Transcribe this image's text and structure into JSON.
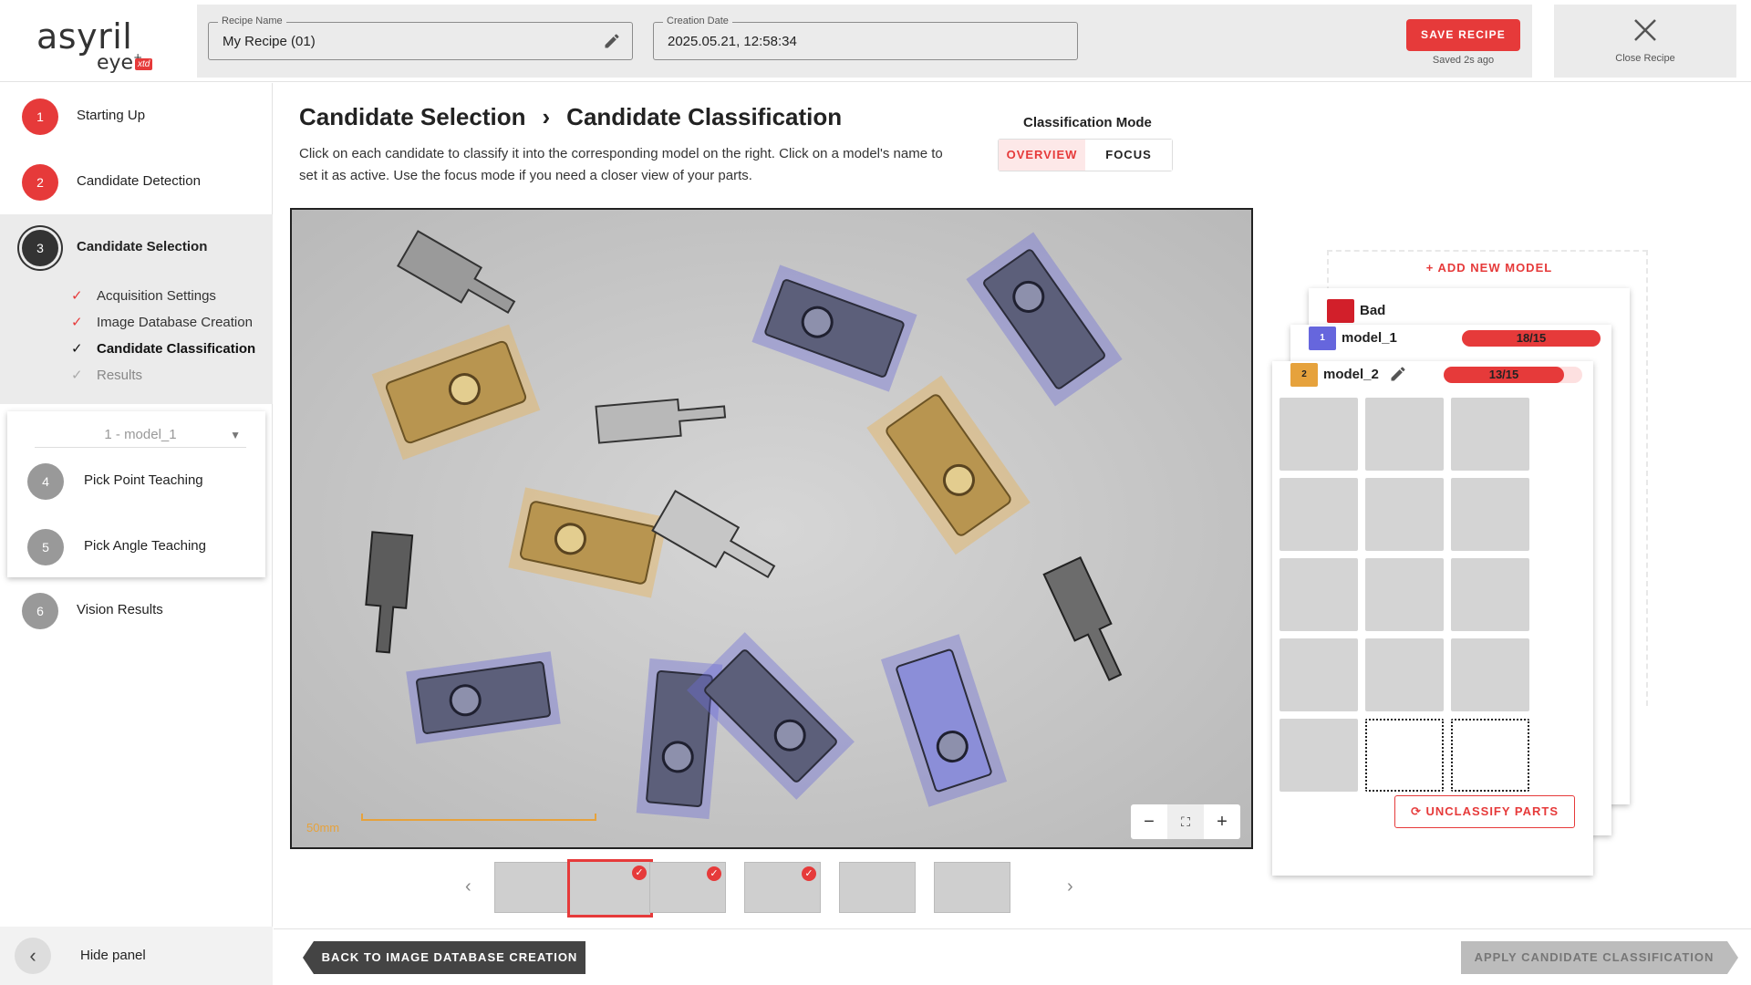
{
  "header": {
    "logo_main": "asyril",
    "logo_sub": "eye",
    "logo_plus": "+",
    "logo_xtd": "xtd",
    "recipe_name_label": "Recipe Name",
    "recipe_name_value": "My Recipe (01)",
    "creation_date_label": "Creation Date",
    "creation_date_value": "2025.05.21, 12:58:34",
    "save_label": "SAVE RECIPE",
    "saved_text": "Saved 2s ago",
    "close_label": "Close Recipe"
  },
  "sidebar": {
    "steps": [
      {
        "num": "1",
        "label": "Starting Up",
        "color": "#e63a3a"
      },
      {
        "num": "2",
        "label": "Candidate Detection",
        "color": "#e63a3a"
      },
      {
        "num": "3",
        "label": "Candidate Selection",
        "color": "#333333"
      },
      {
        "num": "4",
        "label": "Pick Point Teaching",
        "color": "#999999"
      },
      {
        "num": "5",
        "label": "Pick Angle Teaching",
        "color": "#999999"
      },
      {
        "num": "6",
        "label": "Vision Results",
        "color": "#999999"
      }
    ],
    "sub_items": [
      {
        "label": "Acquisition Settings",
        "state": "done"
      },
      {
        "label": "Image Database Creation",
        "state": "done"
      },
      {
        "label": "Candidate Classification",
        "state": "current"
      },
      {
        "label": "Results",
        "state": "pending"
      }
    ],
    "model_select": "1 - model_1",
    "hide_label": "Hide panel"
  },
  "main": {
    "title_part1": "Candidate Selection",
    "title_part2": "Candidate Classification",
    "description": "Click on each candidate to classify it into the corresponding model on the right. Click on a model's name to set it as active. Use the focus mode if you need a closer view of your parts.",
    "mode_label": "Classification Mode",
    "mode_overview": "OVERVIEW",
    "mode_focus": "FOCUS",
    "scale_text": "50mm",
    "zoom_out": "−",
    "zoom_in": "+",
    "back_label": "BACK TO IMAGE DATABASE CREATION",
    "apply_label": "APPLY CANDIDATE CLASSIFICATION"
  },
  "thumbnails": [
    {
      "checked": false,
      "selected": false
    },
    {
      "checked": true,
      "selected": true
    },
    {
      "checked": true,
      "selected": false
    },
    {
      "checked": true,
      "selected": false
    },
    {
      "checked": false,
      "selected": false
    },
    {
      "checked": false,
      "selected": false
    }
  ],
  "models": {
    "add_label": "+ ADD NEW MODEL",
    "bad": {
      "name": "Bad",
      "color": "#d21f2a"
    },
    "model_1": {
      "num": "1",
      "name": "model_1",
      "count": "18/15",
      "color": "#6666dd"
    },
    "model_2": {
      "num": "2",
      "name": "model_2",
      "count": "13/15",
      "color": "#e6a23c"
    },
    "unclassify_label": "UNCLASSIFY PARTS",
    "filled_cells": 13,
    "empty_cells": 2
  },
  "colors": {
    "accent": "#e63a3a",
    "model1_overlay": "#6b6bd6",
    "model2_overlay": "#e6b35c"
  }
}
